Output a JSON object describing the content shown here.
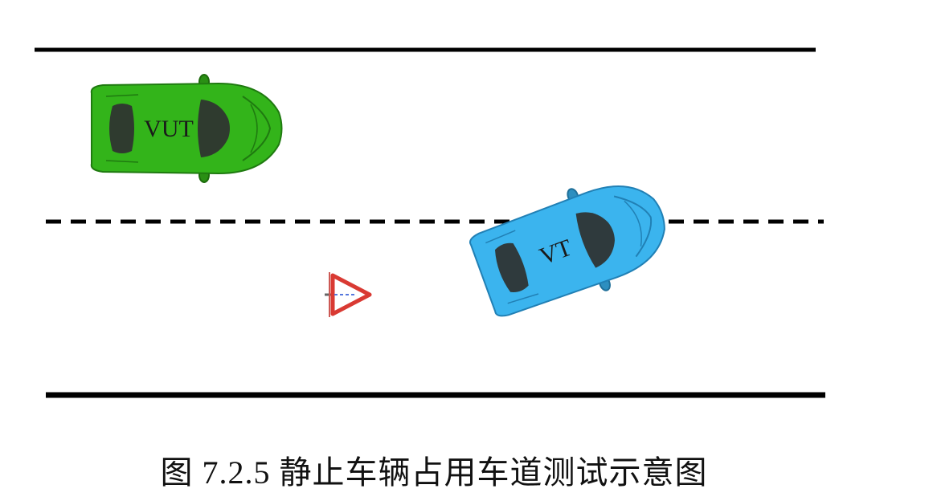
{
  "figure": {
    "caption": "图 7.2.5 静止车辆占用车道测试示意图"
  },
  "vehicles": {
    "vut": {
      "label": "VUT",
      "color": "#33b41a"
    },
    "vt": {
      "label": "VT",
      "color": "#3bb4ee"
    }
  },
  "warning_triangle": {
    "icon": "warning-triangle-icon",
    "color": "#d93a33"
  },
  "road": {
    "line_color": "#000000"
  }
}
